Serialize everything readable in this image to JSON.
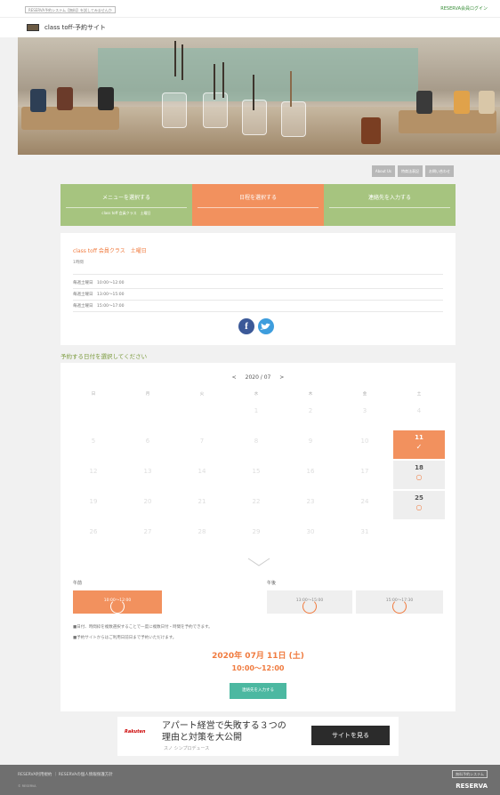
{
  "topbar": {
    "notice": "RESERVA予約システム【無料】を試してみませんか",
    "login": "RESERVA会員ログイン"
  },
  "header": {
    "site_title": "class toff-予約サイト"
  },
  "tab_links": [
    "About Us",
    "特商法表記",
    "お問い合わせ"
  ],
  "steps": [
    {
      "title": "メニューを選択する",
      "sub": "class toff 会員クラス　土曜日",
      "state": "done"
    },
    {
      "title": "日程を選択する",
      "sub": "",
      "state": "current"
    },
    {
      "title": "連絡先を入力する",
      "sub": "",
      "state": "pending"
    }
  ],
  "menu": {
    "name": "class toff 会員クラス　土曜日",
    "duration": "1時間",
    "schedules": [
      "毎週土曜日　10:00〜12:00",
      "毎週土曜日　13:00〜15:00",
      "毎週土曜日　15:00〜17:00"
    ]
  },
  "select_heading": "予約する日付を選択してください",
  "calendar": {
    "month": "2020 / 07",
    "prev": "<",
    "next": ">",
    "weekdays": [
      "日",
      "月",
      "火",
      "水",
      "木",
      "金",
      "土"
    ],
    "weeks": [
      [
        {
          "d": ""
        },
        {
          "d": ""
        },
        {
          "d": ""
        },
        {
          "d": "1"
        },
        {
          "d": "2"
        },
        {
          "d": "3"
        },
        {
          "d": "4"
        }
      ],
      [
        {
          "d": "5"
        },
        {
          "d": "6"
        },
        {
          "d": "7"
        },
        {
          "d": "8"
        },
        {
          "d": "9"
        },
        {
          "d": "10"
        },
        {
          "d": "11",
          "s": "selected",
          "m": "✓"
        }
      ],
      [
        {
          "d": "12"
        },
        {
          "d": "13"
        },
        {
          "d": "14"
        },
        {
          "d": "15"
        },
        {
          "d": "16"
        },
        {
          "d": "17"
        },
        {
          "d": "18",
          "s": "avail",
          "m": "○"
        }
      ],
      [
        {
          "d": "19"
        },
        {
          "d": "20"
        },
        {
          "d": "21"
        },
        {
          "d": "22"
        },
        {
          "d": "23"
        },
        {
          "d": "24"
        },
        {
          "d": "25",
          "s": "avail",
          "m": "○"
        }
      ],
      [
        {
          "d": "26"
        },
        {
          "d": "27"
        },
        {
          "d": "28"
        },
        {
          "d": "29"
        },
        {
          "d": "30"
        },
        {
          "d": "31"
        },
        {
          "d": ""
        }
      ]
    ]
  },
  "periods": {
    "am": "午前",
    "pm": "午後"
  },
  "slots": [
    {
      "label": "10:00〜12:00",
      "state": "selected"
    },
    {
      "label": "13:00〜15:00",
      "state": "available"
    },
    {
      "label": "15:00〜17:30",
      "state": "available"
    }
  ],
  "notes": [
    "■日付、時間枠を複数選択することで一度に複数日付・時間を予約できます。",
    "■予約サイトからはご利用日前日まで予約いただけます。"
  ],
  "selection": {
    "date": "2020年 07月 11日 (土)",
    "time": "10:00〜12:00"
  },
  "next_button": "連絡先を入力する",
  "ad": {
    "logo": "Rakuten",
    "line1": "アパート経営で失敗する３つの",
    "line2": "理由と対策を大公開",
    "sponsor": "スノ シンプロデュース",
    "button": "サイトを見る"
  },
  "footer": {
    "links": "RESERVA利用規約 ｜ RESERVAの個人情報保護方針",
    "copyright": "© RESERVA",
    "system": "無料予約システム",
    "brand": "RESERVA"
  },
  "colors": {
    "orange": "#f2915e",
    "green": "#a6c47f",
    "teal": "#4cb8a1"
  }
}
